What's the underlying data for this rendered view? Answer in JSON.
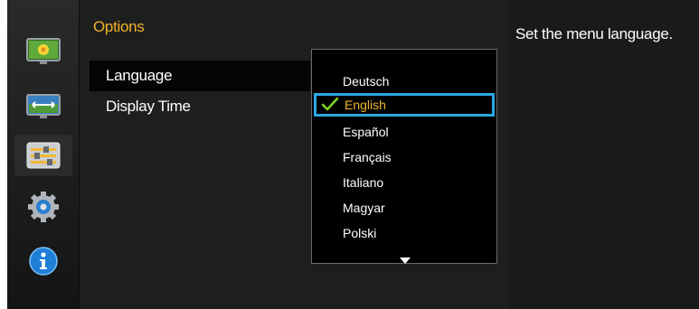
{
  "rail": {
    "icons": [
      "picture-icon",
      "screen-size-icon",
      "options-sliders-icon",
      "setup-gear-icon",
      "information-icon"
    ],
    "selected_index": 2
  },
  "panel": {
    "title": "Options",
    "items": [
      {
        "label": "Language",
        "active": true
      },
      {
        "label": "Display Time",
        "active": false
      }
    ]
  },
  "dropdown": {
    "options": [
      "Deutsch",
      "English",
      "Español",
      "Français",
      "Italiano",
      "Magyar",
      "Polski"
    ],
    "selected": "English"
  },
  "help": {
    "text": "Set the menu language."
  },
  "colors": {
    "title": "#f0b428",
    "selection_border": "#2aa8e0",
    "check": "#7ed321"
  }
}
